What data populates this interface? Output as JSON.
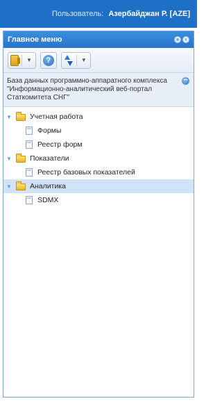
{
  "topbar": {
    "user_label": "Пользователь:",
    "user_name": "Азербайджан Р. [AZE]"
  },
  "panel": {
    "title": "Главное меню",
    "header_icons": [
      "double-chevron-icon",
      "collapse-icon"
    ]
  },
  "toolbar": {
    "buttons": [
      {
        "icon": "database-icon",
        "has_dropdown": true
      },
      {
        "icon": "help-icon",
        "has_dropdown": false
      },
      {
        "icon": "sort-icon",
        "has_dropdown": true
      }
    ]
  },
  "info": {
    "text": "База данных программно-аппаратного комплекса \"Информационно-аналитический веб-портал Статкомитета СНГ\""
  },
  "tree": {
    "groups": [
      {
        "label": "Учетная работа",
        "expanded": true,
        "selected": false,
        "children": [
          "Формы",
          "Реестр форм"
        ]
      },
      {
        "label": "Показатели",
        "expanded": true,
        "selected": false,
        "children": [
          "Реестр базовых показателей"
        ]
      },
      {
        "label": "Аналитика",
        "expanded": true,
        "selected": true,
        "children": [
          "SDMX"
        ]
      }
    ]
  },
  "colors": {
    "topbar": "#1e6fc6",
    "panel_header": "#2874c9",
    "selection": "#d3e3f7",
    "info_bg": "#e8eef6"
  }
}
